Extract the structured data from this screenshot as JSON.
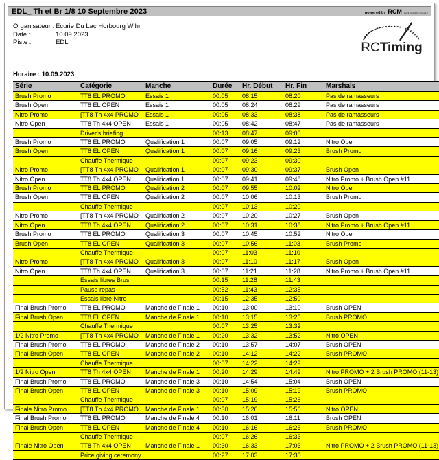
{
  "window": {
    "title": "EDL_ Th et Br 1/8 10 Septembre 2023",
    "powered_by_label": "powered by",
    "powered_by_brand": "RCM",
    "version": "v2.4.0.1189 / 14212"
  },
  "info": {
    "organisateur_label": "Organisateur :",
    "organisateur_value": "Ecurie Du Lac Horbourg Wihr",
    "date_label": "Date :",
    "date_value": "10.09.2023",
    "piste_label": "Piste :",
    "piste_value": "EDL"
  },
  "logo": {
    "text_rc": "RC",
    "text_timing": "Timing",
    "icon": "speedometer-gauge-icon"
  },
  "schedule": {
    "heading": "Horaire : 10.09.2023",
    "columns": [
      "Série",
      "Catégorie",
      "Manche",
      "Durée",
      "Hr. Début",
      "Hr. Fin",
      "Marshals"
    ],
    "rows": [
      {
        "serie": "Brush Promo",
        "categorie": "TT8 EL PROMO",
        "manche": "Essais 1",
        "duree": "00:05",
        "debut": "08:15",
        "fin": "08:20",
        "marshals": "Pas de ramasseurs",
        "hl": true
      },
      {
        "serie": "Brush Open",
        "categorie": "TT8 EL OPEN",
        "manche": "Essais 1",
        "duree": "00:05",
        "debut": "08:24",
        "fin": "08:29",
        "marshals": "Pas de ramasseurs",
        "hl": false
      },
      {
        "serie": "Nitro Promo",
        "categorie": "[TT8 Th 4x4 PROMO",
        "manche": "Essais 1",
        "duree": "00:05",
        "debut": "08:33",
        "fin": "08:38",
        "marshals": "Pas de ramasseurs",
        "hl": true
      },
      {
        "serie": "Nitro Open",
        "categorie": "TT8 Th 4x4 OPEN",
        "manche": "Essais 1",
        "duree": "00:05",
        "debut": "08:42",
        "fin": "08:47",
        "marshals": "Pas de ramasseurs",
        "hl": false
      },
      {
        "serie": "",
        "categorie": "Driver's briefing",
        "manche": "",
        "duree": "00:13",
        "debut": "08:47",
        "fin": "09:00",
        "marshals": "",
        "hl": true
      },
      {
        "serie": "Brush Promo",
        "categorie": "TT8 EL PROMO",
        "manche": "Qualification 1",
        "duree": "00:07",
        "debut": "09:05",
        "fin": "09:12",
        "marshals": "Nitro Open",
        "hl": false
      },
      {
        "serie": "Brush Open",
        "categorie": "TT8 EL OPEN",
        "manche": "Qualification 1",
        "duree": "00:07",
        "debut": "09:16",
        "fin": "09:23",
        "marshals": "Brush Promo",
        "hl": true
      },
      {
        "serie": "",
        "categorie": "Chauffe Thermique",
        "manche": "",
        "duree": "00:07",
        "debut": "09:23",
        "fin": "09:30",
        "marshals": "",
        "hl": true
      },
      {
        "serie": "Nitro Promo",
        "categorie": "[TT8 Th 4x4 PROMO",
        "manche": "Qualification 1",
        "duree": "00:07",
        "debut": "09:30",
        "fin": "09:37",
        "marshals": "Brush Open",
        "hl": true
      },
      {
        "serie": "Nitro Open",
        "categorie": "TT8 Th 4x4 OPEN",
        "manche": "Qualification 1",
        "duree": "00:07",
        "debut": "09:41",
        "fin": "09:48",
        "marshals": "Nitro Promo + Brush Open #11",
        "hl": false
      },
      {
        "serie": "Brush Promo",
        "categorie": "TT8 EL PROMO",
        "manche": "Qualification 2",
        "duree": "00:07",
        "debut": "09:55",
        "fin": "10:02",
        "marshals": "Nitro Open",
        "hl": true
      },
      {
        "serie": "Brush Open",
        "categorie": "TT8 EL OPEN",
        "manche": "Qualification 2",
        "duree": "00:07",
        "debut": "10:06",
        "fin": "10:13",
        "marshals": "Brush Promo",
        "hl": false
      },
      {
        "serie": "",
        "categorie": "Chauffe Thermique",
        "manche": "",
        "duree": "00:07",
        "debut": "10:13",
        "fin": "10:20",
        "marshals": "",
        "hl": true
      },
      {
        "serie": "Nitro Promo",
        "categorie": "[TT8 Th 4x4 PROMO",
        "manche": "Qualification 2",
        "duree": "00:07",
        "debut": "10:20",
        "fin": "10:27",
        "marshals": "Brush Open",
        "hl": false
      },
      {
        "serie": "Nitro Open",
        "categorie": "TT8 Th 4x4 OPEN",
        "manche": "Qualification 2",
        "duree": "00:07",
        "debut": "10:31",
        "fin": "10:38",
        "marshals": "Nitro Promo + Brush Open #11",
        "hl": true
      },
      {
        "serie": "Brush Promo",
        "categorie": "TT8 EL PROMO",
        "manche": "Qualification 3",
        "duree": "00:07",
        "debut": "10:45",
        "fin": "10:52",
        "marshals": "Nitro Open",
        "hl": false
      },
      {
        "serie": "Brush Open",
        "categorie": "TT8 EL OPEN",
        "manche": "Qualification 3",
        "duree": "00:07",
        "debut": "10:56",
        "fin": "11:03",
        "marshals": "Brush Promo",
        "hl": true
      },
      {
        "serie": "",
        "categorie": "Chauffe Thermique",
        "manche": "",
        "duree": "00:07",
        "debut": "11:03",
        "fin": "11:10",
        "marshals": "",
        "hl": true
      },
      {
        "serie": "Nitro Promo",
        "categorie": "[TT8 Th 4x4 PROMO",
        "manche": "Qualification 3",
        "duree": "00:07",
        "debut": "11:10",
        "fin": "11:17",
        "marshals": "Brush Open",
        "hl": true
      },
      {
        "serie": "Nitro Open",
        "categorie": "TT8 Th 4x4 OPEN",
        "manche": "Qualification 3",
        "duree": "00:07",
        "debut": "11:21",
        "fin": "11:28",
        "marshals": "Nitro Promo + Brush Open #11",
        "hl": false
      },
      {
        "serie": "",
        "categorie": "Essais libres Brush",
        "manche": "",
        "duree": "00:15",
        "debut": "11:28",
        "fin": "11:43",
        "marshals": "",
        "hl": true
      },
      {
        "serie": "",
        "categorie": "Pause repas",
        "manche": "",
        "duree": "00:52",
        "debut": "11:43",
        "fin": "12:35",
        "marshals": "",
        "hl": true
      },
      {
        "serie": "",
        "categorie": "Essais libre Nitro",
        "manche": "",
        "duree": "00:15",
        "debut": "12:35",
        "fin": "12:50",
        "marshals": "",
        "hl": true
      },
      {
        "serie": "Final Brush Promo",
        "categorie": "TT8 EL PROMO",
        "manche": "Manche de Finale 1",
        "duree": "00:10",
        "debut": "13:00",
        "fin": "13:10",
        "marshals": "Brush OPEN",
        "hl": false
      },
      {
        "serie": "Final Brush Open",
        "categorie": "TT8 EL OPEN",
        "manche": "Manche de Finale 1",
        "duree": "00:10",
        "debut": "13:15",
        "fin": "13:25",
        "marshals": "Brush PROMO",
        "hl": true
      },
      {
        "serie": "",
        "categorie": "Chauffe Thermique",
        "manche": "",
        "duree": "00:07",
        "debut": "13:25",
        "fin": "13:32",
        "marshals": "",
        "hl": true
      },
      {
        "serie": "1/2 Nitro Promo",
        "categorie": "[TT8 Th 4x4 PROMO",
        "manche": "Manche de Finale 1",
        "duree": "00:20",
        "debut": "13:32",
        "fin": "13:52",
        "marshals": "Nitro OPEN",
        "hl": true
      },
      {
        "serie": "Final Brush Promo",
        "categorie": "TT8 EL PROMO",
        "manche": "Manche de Finale 2",
        "duree": "00:10",
        "debut": "13:57",
        "fin": "14:07",
        "marshals": "Brush OPEN",
        "hl": false
      },
      {
        "serie": "Final Brush Open",
        "categorie": "TT8 EL OPEN",
        "manche": "Manche de Finale 2",
        "duree": "00:10",
        "debut": "14:12",
        "fin": "14:22",
        "marshals": "Brush PROMO",
        "hl": true
      },
      {
        "serie": "",
        "categorie": "Chauffe Thermique",
        "manche": "",
        "duree": "00:07",
        "debut": "14:22",
        "fin": "14:29",
        "marshals": "",
        "hl": true
      },
      {
        "serie": "1/2 Nitro Open",
        "categorie": "TT8 Th 4x4 OPEN",
        "manche": "Manche de Finale 1",
        "duree": "00:20",
        "debut": "14:29",
        "fin": "14:49",
        "marshals": "Nitro PROMO + 2 Brush PROMO (11-13)",
        "hl": true
      },
      {
        "serie": "Final Brush Promo",
        "categorie": "TT8 EL PROMO",
        "manche": "Manche de Finale 3",
        "duree": "00:10",
        "debut": "14:54",
        "fin": "15:04",
        "marshals": "Brush OPEN",
        "hl": false
      },
      {
        "serie": "Final Brush Open",
        "categorie": "TT8 EL OPEN",
        "manche": "Manche de Finale 3",
        "duree": "00:10",
        "debut": "15:09",
        "fin": "15:19",
        "marshals": "Brush PROMO",
        "hl": true
      },
      {
        "serie": "",
        "categorie": "Chauffe Thermique",
        "manche": "",
        "duree": "00:07",
        "debut": "15:19",
        "fin": "15:26",
        "marshals": "",
        "hl": true
      },
      {
        "serie": "Finale Nitro Promo",
        "categorie": "[TT8 Th 4x4 PROMO",
        "manche": "Manche de Finale 1",
        "duree": "00:30",
        "debut": "15:26",
        "fin": "15:56",
        "marshals": "Nitro OPEN",
        "hl": true
      },
      {
        "serie": "Final Brush Promo",
        "categorie": "TT8 EL PROMO",
        "manche": "Manche de Finale 4",
        "duree": "00:10",
        "debut": "16:01",
        "fin": "16:11",
        "marshals": "Brush OPEN",
        "hl": false
      },
      {
        "serie": "Final Brush Open",
        "categorie": "TT8 EL OPEN",
        "manche": "Manche de Finale 4",
        "duree": "00:10",
        "debut": "16:16",
        "fin": "16:26",
        "marshals": "Brush PROMO",
        "hl": true
      },
      {
        "serie": "",
        "categorie": "Chauffe Thermique",
        "manche": "",
        "duree": "00:07",
        "debut": "16:26",
        "fin": "16:33",
        "marshals": "",
        "hl": true
      },
      {
        "serie": "Finale Nitro Open",
        "categorie": "TT8 Th 4x4 OPEN",
        "manche": "Manche de Finale 1",
        "duree": "00:30",
        "debut": "16:33",
        "fin": "17:03",
        "marshals": "Nitro PROMO + 2 Brush PROMO (11-13)",
        "hl": true
      },
      {
        "serie": "",
        "categorie": "Price giving ceremony",
        "manche": "",
        "duree": "00:27",
        "debut": "17:03",
        "fin": "17:30",
        "marshals": "",
        "hl": true
      }
    ]
  },
  "colors": {
    "highlight": "#ffff00",
    "header_gray": "#c0c0c0",
    "border": "#000000"
  }
}
